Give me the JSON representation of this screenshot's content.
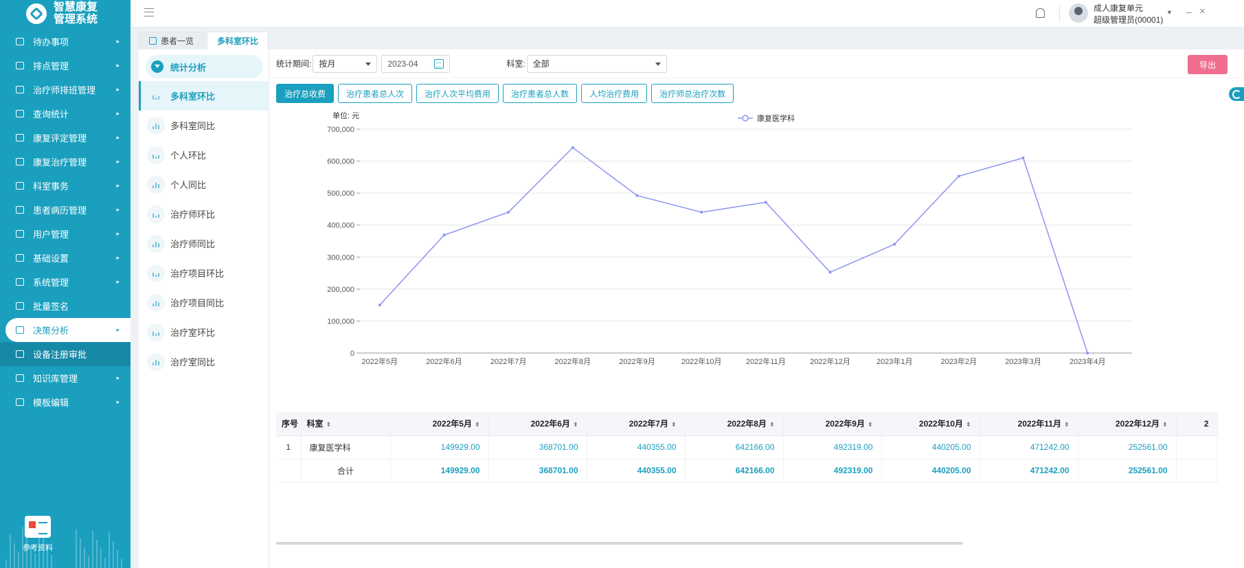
{
  "app": {
    "name_line1": "智慧康复",
    "name_line2": "管理系统"
  },
  "sidebar": {
    "items": [
      {
        "label": "待办事项",
        "name": "todo",
        "arrow": true
      },
      {
        "label": "排点管理",
        "name": "schedule-point",
        "arrow": true
      },
      {
        "label": "治疗师排班管理",
        "name": "therapist-shift",
        "arrow": true
      },
      {
        "label": "查询统计",
        "name": "query-stats",
        "arrow": true
      },
      {
        "label": "康复评定管理",
        "name": "rehab-assessment",
        "arrow": true
      },
      {
        "label": "康复治疗管理",
        "name": "rehab-treatment",
        "arrow": true
      },
      {
        "label": "科室事务",
        "name": "dept-affairs",
        "arrow": true
      },
      {
        "label": "患者病历管理",
        "name": "patient-records",
        "arrow": true
      },
      {
        "label": "用户管理",
        "name": "user-management",
        "arrow": true
      },
      {
        "label": "基础设置",
        "name": "basic-settings",
        "arrow": true
      },
      {
        "label": "系统管理",
        "name": "system-management",
        "arrow": true
      },
      {
        "label": "批量签名",
        "name": "batch-signature",
        "arrow": false
      },
      {
        "label": "决策分析",
        "name": "decision-analysis",
        "arrow": true,
        "active": true
      },
      {
        "label": "设备注册审批",
        "name": "device-registration",
        "arrow": false,
        "sub": true
      },
      {
        "label": "知识库管理",
        "name": "knowledge-base",
        "arrow": true
      },
      {
        "label": "模板编辑",
        "name": "template-edit",
        "arrow": true
      }
    ],
    "reference_label": "参考资料"
  },
  "header": {
    "user_unit": "成人康复单元",
    "user_role": "超级管理员(00001)",
    "minimize": "–",
    "close": "×"
  },
  "tabs": [
    {
      "label": "患者一览",
      "active": false
    },
    {
      "label": "多科室环比",
      "active": true
    }
  ],
  "subnav": {
    "header": "统计分析",
    "items": [
      {
        "label": "多科室环比",
        "active": true
      },
      {
        "label": "多科室同比"
      },
      {
        "label": "个人环比"
      },
      {
        "label": "个人同比"
      },
      {
        "label": "治疗师环比"
      },
      {
        "label": "治疗师同比"
      },
      {
        "label": "治疗项目环比"
      },
      {
        "label": "治疗项目同比"
      },
      {
        "label": "治疗室环比"
      },
      {
        "label": "治疗室同比"
      }
    ]
  },
  "filters": {
    "period_label": "统计期间:",
    "period_value": "按月",
    "month_value": "2023-04",
    "dept_label": "科室:",
    "dept_value": "全部",
    "export_label": "导出"
  },
  "metrics": [
    {
      "label": "治疗总收费",
      "active": true
    },
    {
      "label": "治疗患者总人次"
    },
    {
      "label": "治疗人次平均费用"
    },
    {
      "label": "治疗患者总人数"
    },
    {
      "label": "人均治疗费用"
    },
    {
      "label": "治疗师总治疗次数"
    }
  ],
  "chart_data": {
    "type": "line",
    "unit_label": "单位: 元",
    "legend": "康复医学科",
    "legend_position": "top-center",
    "x": [
      "2022年5月",
      "2022年6月",
      "2022年7月",
      "2022年8月",
      "2022年9月",
      "2022年10月",
      "2022年11月",
      "2022年12月",
      "2023年1月",
      "2023年2月",
      "2023年3月",
      "2023年4月"
    ],
    "series": [
      {
        "name": "康复医学科",
        "values": [
          149929,
          368701,
          440355,
          642166,
          492319,
          440205,
          471242,
          252561,
          340000,
          553000,
          610000,
          0
        ]
      }
    ],
    "ylim": [
      0,
      700000
    ],
    "yticks": [
      "0",
      "100,000",
      "200,000",
      "300,000",
      "400,000",
      "500,000",
      "600,000",
      "700,000"
    ],
    "grid": true,
    "color": "#8c93f0"
  },
  "table": {
    "headers": [
      "序号",
      "科室",
      "2022年5月",
      "2022年6月",
      "2022年7月",
      "2022年8月",
      "2022年9月",
      "2022年10月",
      "2022年11月",
      "2022年12月",
      "2"
    ],
    "rows": [
      [
        "1",
        "康复医学科",
        "149929.00",
        "368701.00",
        "440355.00",
        "642166.00",
        "492319.00",
        "440205.00",
        "471242.00",
        "252561.00",
        ""
      ]
    ],
    "total_row": [
      "",
      "合计",
      "149929.00",
      "368701.00",
      "440355.00",
      "642166.00",
      "492319.00",
      "440205.00",
      "471242.00",
      "252561.00",
      ""
    ]
  }
}
